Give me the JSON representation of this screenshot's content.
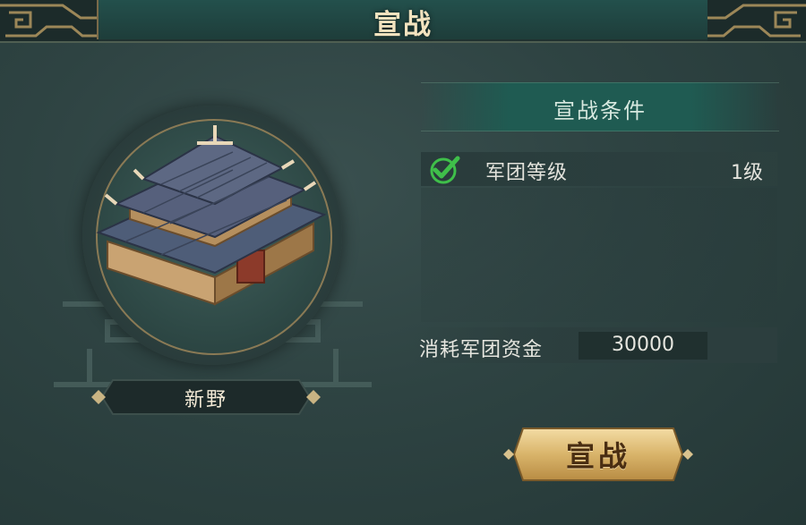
{
  "header": {
    "title": "宣战"
  },
  "city": {
    "name": "新野",
    "image_icon": "palace-building-icon"
  },
  "conditions": {
    "title": "宣战条件",
    "items": [
      {
        "icon": "check-icon",
        "label": "军团等级",
        "value": "1级",
        "met": true
      }
    ]
  },
  "cost": {
    "label": "消耗军团资金",
    "value": "30000"
  },
  "action": {
    "declare_label": "宣战"
  },
  "colors": {
    "panel_bg": "#2e4342",
    "title_text": "#f2e3bf",
    "condition_header_bg": "#1f5b52",
    "check_green": "#3fbf4a",
    "button_gold": "#d9b46a"
  }
}
